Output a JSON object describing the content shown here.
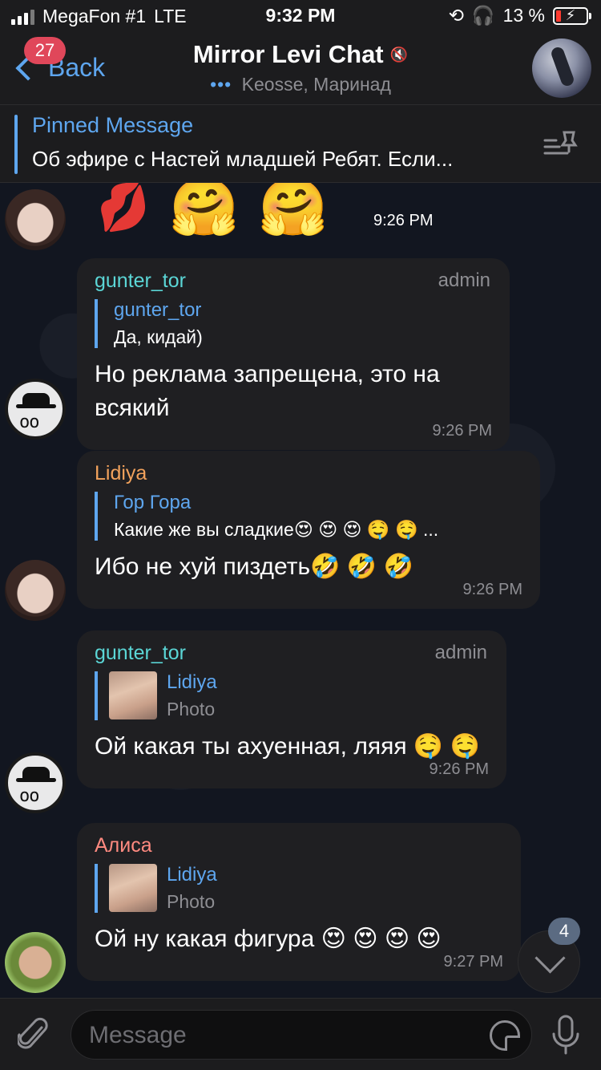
{
  "status_bar": {
    "carrier": "MegaFon #1",
    "network": "LTE",
    "time": "9:32 PM",
    "battery": "13 %"
  },
  "header": {
    "back_label": "Back",
    "unread_count": "27",
    "title": "Mirror Levi Chat",
    "subtitle": "Keosse, Маринад"
  },
  "pinned": {
    "title": "Pinned Message",
    "text": "Об эфире с Настей младшей Ребят. Если..."
  },
  "colors": {
    "accent": "#5ea6ef",
    "unread_badge": "#e0475a",
    "gunter": "#5bd6d6",
    "lidiya": "#f2a25c",
    "alisa": "#ff8a80"
  },
  "messages": {
    "sticker_time": "9:26 PM",
    "m1": {
      "sender": "gunter_tor",
      "role": "admin",
      "reply_name": "gunter_tor",
      "reply_text": "Да, кидай)",
      "text": "Но реклама запрещена, это на всякий",
      "time": "9:26 PM"
    },
    "m2": {
      "sender": "Lidiya",
      "reply_name": "Гор Гора",
      "reply_text": "Какие же вы сладкие😍 😍 😍 🤤 🤤 ...",
      "text": "Ибо не хуй пиздеть🤣 🤣 🤣",
      "time": "9:26 PM"
    },
    "m3": {
      "sender": "gunter_tor",
      "role": "admin",
      "reply_name": "Lidiya",
      "reply_text": "Photo",
      "text": "Ой какая ты ахуенная, ляяя 🤤 🤤",
      "time": "9:26 PM"
    },
    "m4": {
      "sender": "Алиса",
      "reply_name": "Lidiya",
      "reply_text": "Photo",
      "text": "Ой ну какая фигура 😍 😍 😍 😍",
      "time": "9:27 PM"
    }
  },
  "scroll": {
    "badge": "4"
  },
  "input": {
    "placeholder": "Message"
  }
}
